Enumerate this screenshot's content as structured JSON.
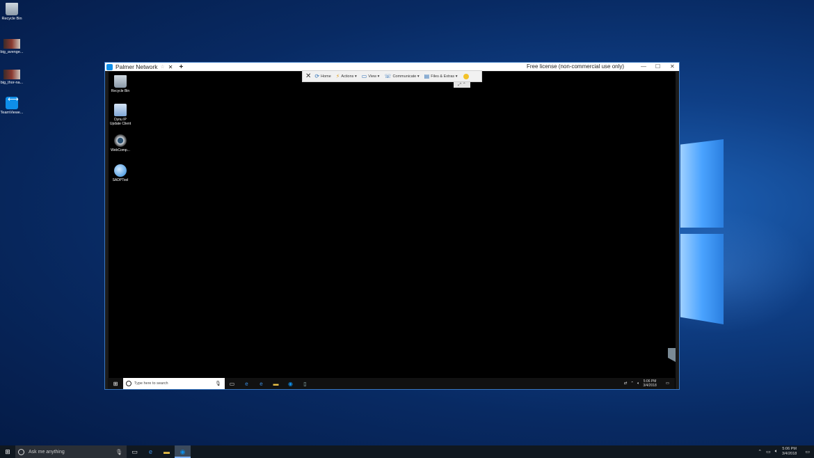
{
  "desktop": {
    "icons": [
      {
        "label": "Recycle Bin"
      },
      {
        "label": "big_avenge..."
      },
      {
        "label": "big_thor-na..."
      },
      {
        "label": "TeamViewe..."
      }
    ]
  },
  "window": {
    "tab_title": "Palmer Network",
    "tab_star": "☆",
    "tab_close": "✕",
    "tab_add": "+",
    "license_text": "Free license (non-commercial use only)",
    "minimize": "—",
    "maximize": "☐",
    "close": "✕"
  },
  "toolbar": {
    "close": "✕",
    "home": "Home",
    "actions": "Actions",
    "view": "View",
    "communicate": "Communicate",
    "files_extras": "Files & Extras",
    "caret": "▾"
  },
  "remote_desktop": {
    "icons": [
      {
        "label": "Recycle Bin"
      },
      {
        "label": "Dynu IP Update Client"
      },
      {
        "label": "WebComp..."
      },
      {
        "label": "SADPTool"
      }
    ],
    "taskbar": {
      "search_placeholder": "Type here to search",
      "time": "5:06 PM",
      "date": "3/4/2018"
    }
  },
  "taskbar": {
    "search_placeholder": "Ask me anything",
    "time": "5:06 PM",
    "date": "3/4/2018"
  }
}
